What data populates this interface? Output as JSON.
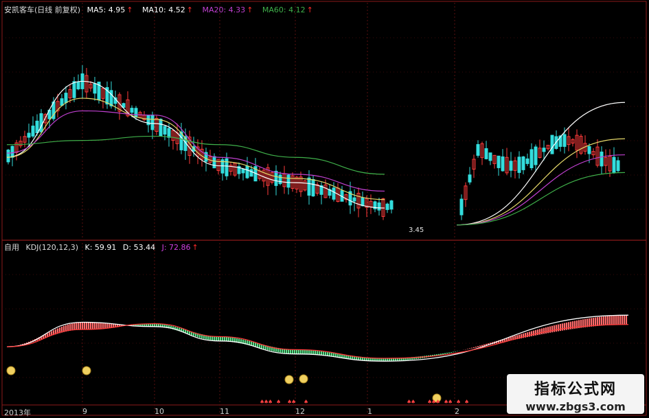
{
  "price_panel": {
    "title": "安凯客车(日线 前复权)",
    "ma5_label": "MA5: 4.95",
    "ma10_label": "MA10: 4.52",
    "ma20_label": "MA20: 4.33",
    "ma60_label": "MA60: 4.12",
    "low_price_label": "3.45",
    "colors": {
      "up": "#ff3b3b",
      "down": "#33dddd",
      "ma5": "#ffffff",
      "ma10": "#e6d96a",
      "ma20": "#c040d0",
      "ma60": "#3fb04a"
    }
  },
  "kdj_panel": {
    "title": "自用",
    "params_label": "KDJ(120,12,3)",
    "k_label": "K: 59.91",
    "d_label": "D: 53.44",
    "j_label": "J: 72.86",
    "colors": {
      "k": "#ffffff",
      "d": "#ff3b3b",
      "j": "#d040e0"
    }
  },
  "axis": {
    "labels": [
      "2013年",
      "9",
      "10",
      "11",
      "12",
      "1",
      "2"
    ]
  },
  "watermark": {
    "name": "指标公式网",
    "url": "www.zbgs3.com"
  },
  "chart_data": [
    {
      "type": "line",
      "title": "安凯客车(日线 前复权)",
      "x": [
        "2013-08",
        "9",
        "10",
        "11",
        "12",
        "1",
        "2"
      ],
      "series": [
        {
          "name": "MA5",
          "values": [
            4.3,
            5.2,
            4.7,
            4.2,
            4.0,
            3.7,
            4.95
          ]
        },
        {
          "name": "MA10",
          "values": [
            4.3,
            5.0,
            4.75,
            4.25,
            4.05,
            3.8,
            4.52
          ]
        },
        {
          "name": "MA20",
          "values": [
            4.35,
            4.85,
            4.8,
            4.3,
            4.1,
            3.9,
            4.33
          ]
        },
        {
          "name": "MA60",
          "values": [
            4.45,
            4.5,
            4.55,
            4.45,
            4.3,
            4.1,
            4.12
          ]
        }
      ]
    },
    {
      "type": "line",
      "title": "KDJ(120,12,3)",
      "x": [
        "2013-08",
        "9",
        "10",
        "11",
        "12",
        "1",
        "2"
      ],
      "series": [
        {
          "name": "K",
          "values": [
            38,
            55,
            52,
            42,
            33,
            28,
            59.91
          ]
        },
        {
          "name": "D",
          "values": [
            38,
            50,
            54,
            45,
            36,
            30,
            53.44
          ]
        },
        {
          "name": "J",
          "values": [
            38,
            65,
            48,
            36,
            28,
            25,
            72.86
          ]
        }
      ]
    }
  ]
}
